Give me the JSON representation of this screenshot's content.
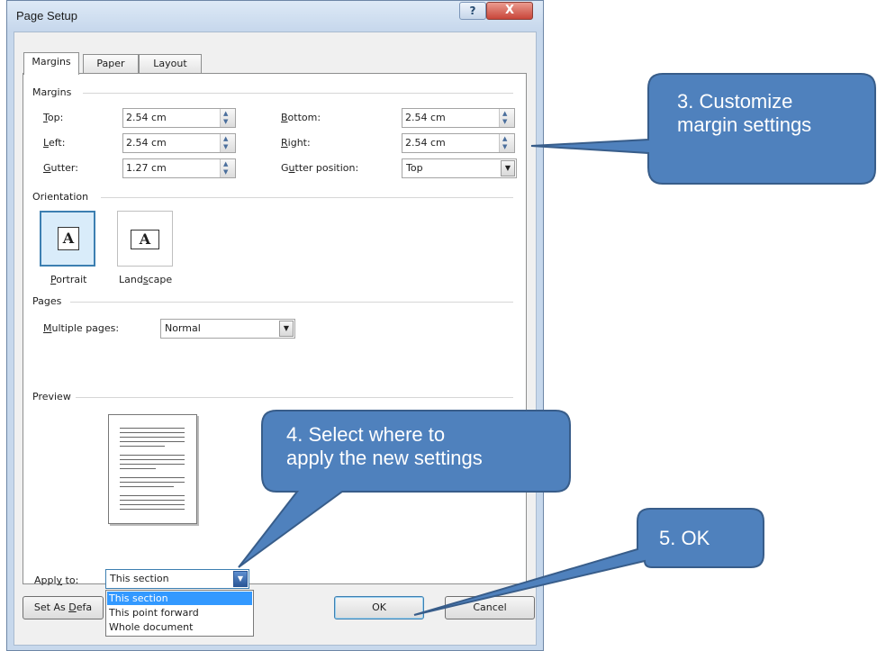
{
  "dialog": {
    "title": "Page Setup",
    "help_glyph": "?",
    "close_glyph": "X",
    "tabs": [
      {
        "label": "Margins",
        "active": true
      },
      {
        "label": "Paper",
        "active": false
      },
      {
        "label": "Layout",
        "active": false
      }
    ]
  },
  "margins": {
    "group_label": "Margins",
    "top": {
      "label_key": "T",
      "label_rest": "op:",
      "value": "2.54 cm"
    },
    "bottom": {
      "label_key": "B",
      "label_rest": "ottom:",
      "value": "2.54 cm"
    },
    "left": {
      "label_key": "L",
      "label_rest": "eft:",
      "value": "2.54 cm"
    },
    "right": {
      "label_key": "R",
      "label_rest": "ight:",
      "value": "2.54 cm"
    },
    "gutter": {
      "label_key": "G",
      "label_rest": "utter:",
      "value": "1.27 cm"
    },
    "gutter_position": {
      "label_pre": "G",
      "label_key": "u",
      "label_rest": "tter position:",
      "value": "Top"
    }
  },
  "orientation": {
    "group_label": "Orientation",
    "portrait": {
      "label_key": "P",
      "label_rest": "ortrait",
      "glyph": "A",
      "selected": true
    },
    "landscape": {
      "label_pre": "Land",
      "label_key": "s",
      "label_rest": "cape",
      "glyph": "A",
      "selected": false
    }
  },
  "pages": {
    "group_label": "Pages",
    "multiple_pages": {
      "label_key": "M",
      "label_rest": "ultiple pages:",
      "value": "Normal"
    }
  },
  "preview": {
    "group_label": "Preview"
  },
  "apply_to": {
    "label_pre": "Appl",
    "label_key": "y",
    "label_rest": " to:",
    "value": "This section",
    "options": [
      "This section",
      "This point forward",
      "Whole document"
    ],
    "selected_index": 0
  },
  "buttons": {
    "set_default_pre": "Set As ",
    "set_default_key": "D",
    "set_default_rest": "efa",
    "ok": "OK",
    "cancel": "Cancel"
  },
  "callouts": {
    "margins": [
      "3. Customize",
      "margin settings"
    ],
    "apply": [
      "4. Select where to",
      "apply the new settings"
    ],
    "ok": "5. OK"
  },
  "colors": {
    "callout_fill": "#4f81bd",
    "callout_stroke": "#385d8a",
    "selection": "#3399ff",
    "frame": "#c7d8ec"
  },
  "icons": {
    "spin_up": "▲",
    "spin_down": "▼",
    "combo_arrow": "▼"
  }
}
